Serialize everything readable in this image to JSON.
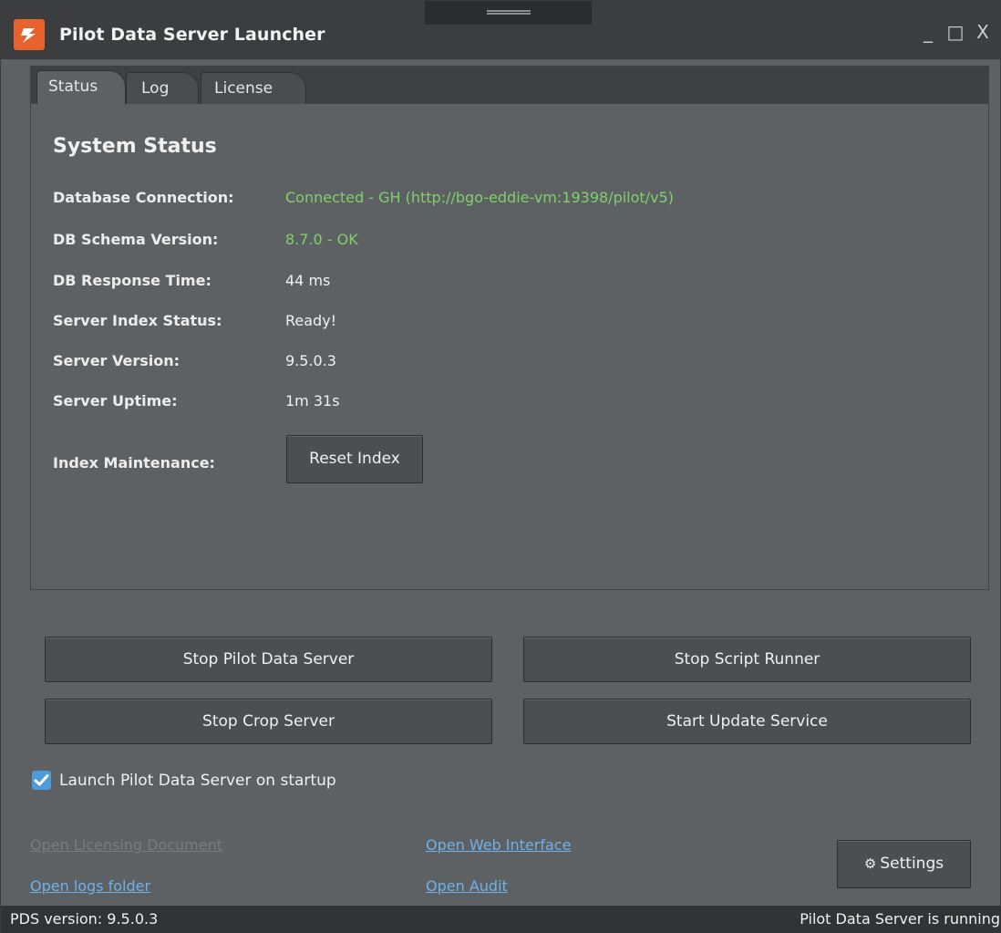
{
  "window": {
    "title": "Pilot Data Server Launcher",
    "controls": {
      "minimize": "_",
      "maximize": "□",
      "close": "X"
    }
  },
  "tabs": [
    {
      "label": "Status",
      "active": true
    },
    {
      "label": "Log",
      "active": false
    },
    {
      "label": "License",
      "active": false
    }
  ],
  "status": {
    "title": "System Status",
    "rows": [
      {
        "label": "Database Connection:",
        "value": "Connected - GH (http://bgo-eddie-vm:19398/pilot/v5)"
      },
      {
        "label": "DB Schema Version:",
        "value": "8.7.0 - OK"
      },
      {
        "label": "DB Response Time:",
        "value": "44 ms"
      },
      {
        "label": "Server Index Status:",
        "value": "Ready!"
      },
      {
        "label": "Server Version:",
        "value": "9.5.0.3"
      },
      {
        "label": "Server Uptime:",
        "value": "1m 31s"
      }
    ],
    "maintenance_label": "Index Maintenance:",
    "reset_button": "Reset Index"
  },
  "actions": {
    "stop_pds": "Stop Pilot Data Server",
    "stop_script": "Stop Script Runner",
    "stop_crop": "Stop Crop Server",
    "start_update": "Start Update Service"
  },
  "startup": {
    "label": "Launch Pilot Data Server on startup",
    "checked": true
  },
  "links": {
    "licensing": "Open Licensing Document",
    "logs": "Open logs folder",
    "web": "Open Web Interface",
    "audit": "Open Audit"
  },
  "settings_button": "Settings",
  "statusbar": {
    "version": "PDS version: 9.5.0.3",
    "state": "Pilot Data Server is running"
  },
  "colors": {
    "accent": "#e8622c",
    "ok_text": "#7fcf6b",
    "link": "#6fb1ea",
    "checkbox": "#4d9bd8"
  }
}
